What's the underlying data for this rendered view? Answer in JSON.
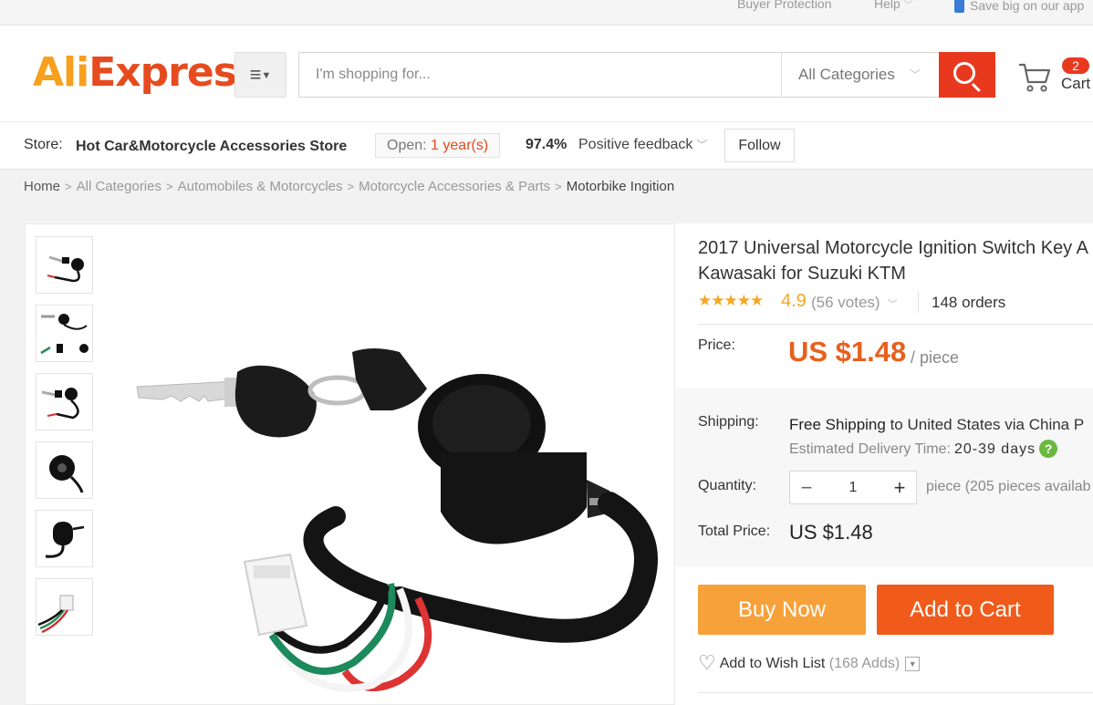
{
  "topbar": {
    "buyer_protection": "Buyer Protection",
    "help": "Help",
    "app_promo": "Save big on our app"
  },
  "header": {
    "logo_primary": "Ali",
    "logo_secondary": "Express",
    "logo_tm": "™",
    "search_placeholder": "I'm shopping for...",
    "search_category": "All Categories",
    "cart_count": "2",
    "cart_label": "Cart"
  },
  "store": {
    "label": "Store:",
    "name": "Hot Car&Motorcycle Accessories Store",
    "open_label": "Open:",
    "open_duration": "1 year(s)",
    "feedback_percent": "97.4%",
    "feedback_label": "Positive feedback",
    "follow_label": "Follow"
  },
  "breadcrumb": {
    "items": [
      "Home",
      "All Categories",
      "Automobiles & Motorcycles",
      "Motorcycle Accessories & Parts",
      "Motorbike Ingition"
    ],
    "separator": ">"
  },
  "gallery": {
    "thumbnails": [
      "ignition-switch-view-1",
      "ignition-switch-view-2",
      "ignition-switch-view-3",
      "ignition-switch-view-4",
      "ignition-switch-view-5",
      "ignition-switch-view-6"
    ]
  },
  "product": {
    "title_line1": "2017 Universal Motorcycle Ignition Switch Key A",
    "title_line2": "Kawasaki for Suzuki KTM",
    "stars": "★★★★★",
    "rating": "4.9",
    "votes": "(56 votes)",
    "orders": "148 orders",
    "price_label": "Price:",
    "price": "US $1.48",
    "price_unit": "/ piece",
    "shipping_label": "Shipping:",
    "shipping_free": "Free Shipping",
    "shipping_to": "to United States via China P",
    "delivery_label": "Estimated Delivery Time:",
    "delivery_days": "20-39 days",
    "quantity_label": "Quantity:",
    "quantity_value": "1",
    "availability": "piece (205 pieces availab",
    "total_label": "Total Price:",
    "total_price": "US $1.48",
    "buy_now": "Buy Now",
    "add_to_cart": "Add to Cart",
    "wishlist_label": "Add to Wish List",
    "wishlist_count": "(168 Adds)"
  },
  "colors": {
    "brand_orange": "#e64b1f",
    "brand_yellow": "#f6a01d",
    "price": "#e8601c",
    "buy_now_bg": "#f7a13a",
    "add_to_cart_bg": "#f05a1a"
  }
}
